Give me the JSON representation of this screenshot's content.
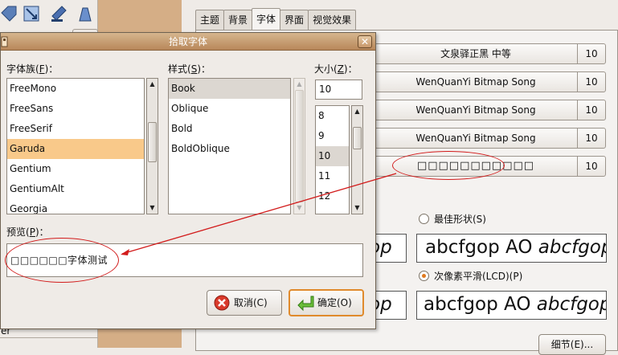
{
  "dialog": {
    "title": "拾取字体",
    "close_glyph": "✕",
    "family_label": "字体族(",
    "family_key": "F",
    "family_label_end": ")：",
    "style_label": "样式(",
    "style_key": "S",
    "style_label_end": ")：",
    "size_label": "大小(",
    "size_key": "Z",
    "size_label_end": ")：",
    "families": [
      "FreeMono",
      "FreeSans",
      "FreeSerif",
      "Garuda",
      "Gentium",
      "GentiumAlt",
      "Georgia"
    ],
    "selected_family": "Garuda",
    "styles": [
      "Book",
      "Oblique",
      "Bold",
      "BoldOblique"
    ],
    "selected_style": "Book",
    "size_value": "10",
    "sizes": [
      "8",
      "9",
      "10",
      "11",
      "12"
    ],
    "selected_size": "10",
    "preview_label": "预览(",
    "preview_key": "P",
    "preview_label_end": ")：",
    "preview_text": "□□□□□□字体测试",
    "cancel_label": "取消(C)",
    "ok_label": "确定(O)"
  },
  "background": {
    "tabs": [
      "主题",
      "背景",
      "字体",
      "界面",
      "视觉效果"
    ],
    "active_tab": "字体",
    "font_buttons": [
      {
        "name": "文泉驿正黑 中等",
        "size": "10"
      },
      {
        "name": "WenQuanYi Bitmap Song",
        "size": "10"
      },
      {
        "name": "WenQuanYi Bitmap Song",
        "size": "10"
      },
      {
        "name": "WenQuanYi Bitmap Song",
        "size": "10"
      },
      {
        "name": "□□□□□□□□□□□",
        "size": "10"
      }
    ],
    "radio_best_shape": "最佳形状(S)",
    "radio_subpixel": "次像素平滑(LCD)(P)",
    "sample_text_1": "abcfgop AO",
    "sample_text_italic": "abcfgop",
    "sample_cut_1": "op",
    "sample_cut_2": "op",
    "details_button": "细节(E)...",
    "left_text": "er"
  },
  "colors": {
    "selection_orange": "#f9c98a",
    "titlebar": "#c89a6a",
    "brown_panel": "#d5ae86",
    "annotation_red": "#d21b1b"
  }
}
